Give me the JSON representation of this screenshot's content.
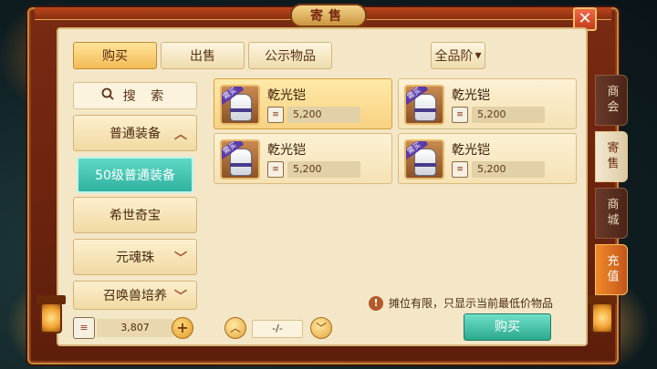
{
  "window": {
    "title": "寄售"
  },
  "tabs": [
    {
      "label": "购买",
      "active": true
    },
    {
      "label": "出售",
      "active": false
    },
    {
      "label": "公示物品",
      "active": false
    }
  ],
  "grade_select": {
    "value": "全品阶",
    "caret": "▾"
  },
  "search": {
    "label": "搜 索",
    "icon": "search-icon"
  },
  "categories": [
    {
      "label": "普通装备",
      "expanded": true
    },
    {
      "label": "50级普通装备",
      "selected": true
    },
    {
      "label": "希世奇宝"
    },
    {
      "label": "元魂珠"
    },
    {
      "label": "召唤兽培养"
    }
  ],
  "items": [
    {
      "name": "乾光铠",
      "price": "5,200",
      "badge": "需买",
      "selected": true
    },
    {
      "name": "乾光铠",
      "price": "5,200",
      "badge": "需买",
      "selected": false
    },
    {
      "name": "乾光铠",
      "price": "5,200",
      "badge": "需买",
      "selected": false
    },
    {
      "name": "乾光铠",
      "price": "5,200",
      "badge": "需买",
      "selected": false
    }
  ],
  "currency": {
    "amount": "3,807",
    "icon": "ticket-icon"
  },
  "pagination": {
    "value": "-/-"
  },
  "notice": {
    "text": "摊位有限，只显示当前最低价物品",
    "icon": "!"
  },
  "buy_button": {
    "label": "购买"
  },
  "side_tabs": [
    {
      "label": "商会"
    },
    {
      "label": "寄售",
      "active": true
    },
    {
      "label": "商城"
    },
    {
      "label": "充值"
    }
  ],
  "colors": {
    "accent_teal": "#2fb2a0",
    "frame_red": "#7a2a12",
    "panel_cream": "#f4e7c8",
    "gold": "#f3bc55"
  }
}
